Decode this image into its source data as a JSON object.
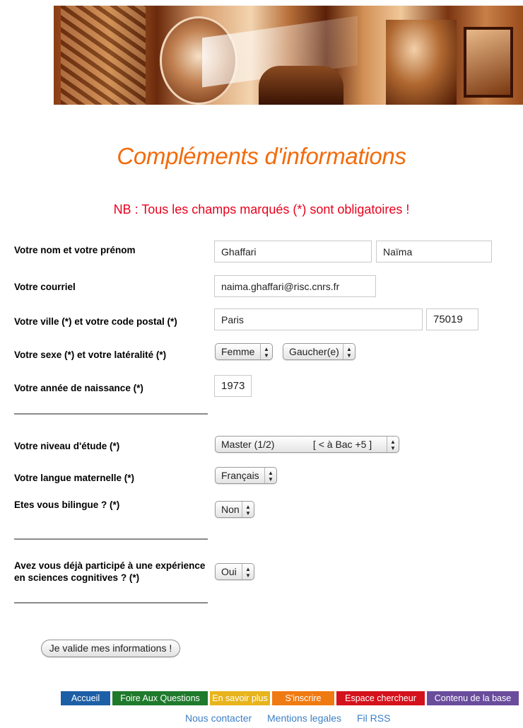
{
  "banner": {
    "image_name": "banner-image"
  },
  "page": {
    "title": "Compléments d'informations",
    "notice": "NB  : Tous les champs marqués (*) sont obligatoires  !"
  },
  "form": {
    "name_label": "Votre nom et votre prénom",
    "last_name": "Ghaffari",
    "first_name": "Naïma",
    "email_label": "Votre courriel",
    "email": "naima.ghaffari@risc.cnrs.fr",
    "city_label": "Votre ville (*) et votre code postal (*)",
    "city": "Paris",
    "postal_code": "75019",
    "sex_label": "Votre sexe (*) et votre latéralité (*)",
    "sex": "Femme",
    "laterality": "Gaucher(e)",
    "birth_year_label": "Votre année de naissance (*)",
    "birth_year": "1973",
    "education_label": "Votre niveau d'étude (*)",
    "education": "Master (1/2)              [ < à Bac +5 ]",
    "language_label": "Votre langue maternelle (*)",
    "language": "Français",
    "bilingual_label": "Etes vous bilingue  ? (*)",
    "bilingual": "Non",
    "experience_label_line1": "Avez vous déjà participé à une expérience",
    "experience_label_line2": "en sciences cognitives  ? (*)",
    "experience": "Oui",
    "submit_label": "Je valide mes informations !"
  },
  "nav": {
    "items": [
      {
        "label": "Accueil",
        "color": "#1d5fa6"
      },
      {
        "label": "Foire Aux Questions",
        "color": "#1f7a2c"
      },
      {
        "label": "En savoir plus",
        "color": "#e8b41c"
      },
      {
        "label": "S'inscrire",
        "color": "#f07a12"
      },
      {
        "label": "Espace chercheur",
        "color": "#d4121c"
      },
      {
        "label": "Contenu de la base",
        "color": "#6a4c9c"
      }
    ]
  },
  "footer": {
    "contact": "Nous contacter",
    "legal": "Mentions legales",
    "rss": "Fil RSS"
  },
  "colors": {
    "title": "#f26b0b",
    "notice": "#e8001c",
    "link": "#3c7fc6"
  },
  "icons": {
    "select_arrows": "up-down-arrows-icon"
  }
}
